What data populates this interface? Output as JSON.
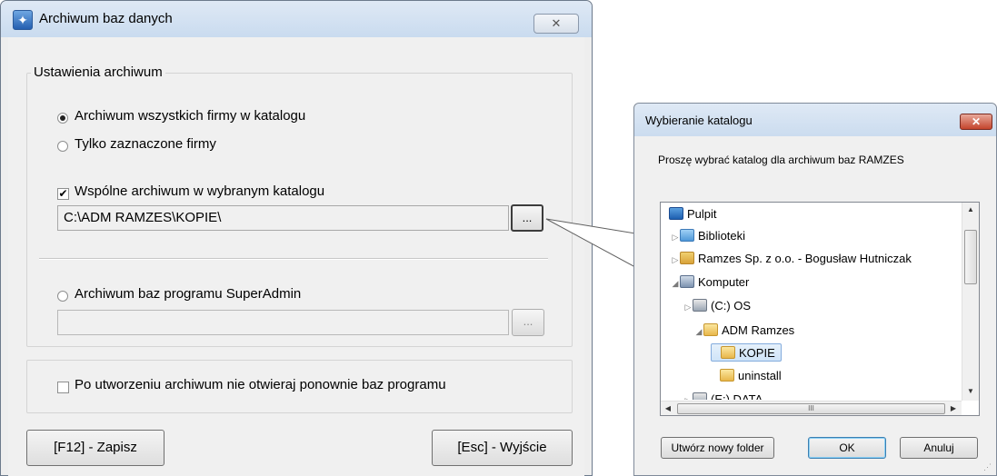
{
  "main_window": {
    "title": "Archiwum baz danych",
    "close_label": "✕",
    "group_title": "Ustawienia archiwum",
    "radio_all": "Archiwum wszystkich firmy w katalogu",
    "radio_selected": "Tylko zaznaczone firmy",
    "checkbox_common": "Wspólne archiwum w wybranym katalogu",
    "checkbox_common_checked": true,
    "path_value": "C:\\ADM RAMZES\\KOPIE\\",
    "browse_label": "...",
    "radio_superadmin": "Archiwum baz programu SuperAdmin",
    "superadmin_path": "",
    "browse2_label": "...",
    "checkbox_noreopen": "Po utworzeniu archiwum nie otwieraj ponownie baz programu",
    "save_button": "[F12] - Zapisz",
    "exit_button": "[Esc] - Wyjście"
  },
  "folder_dialog": {
    "title": "Wybieranie katalogu",
    "close_label": "✕",
    "prompt": "Proszę wybrać katalog dla archiwum baz RAMZES",
    "tree": [
      {
        "label": "Pulpit",
        "icon": "desktop-icon",
        "arrow": ""
      },
      {
        "label": "Biblioteki",
        "icon": "libraries-icon",
        "arrow": "▷"
      },
      {
        "label": "Ramzes Sp. z o.o. - Bogusław Hutniczak",
        "icon": "user-folder-icon",
        "arrow": "▷"
      },
      {
        "label": "Komputer",
        "icon": "computer-icon",
        "arrow": "◢"
      },
      {
        "label": "(C:) OS",
        "icon": "drive-icon",
        "arrow": "▷"
      },
      {
        "label": "ADM Ramzes",
        "icon": "folder-icon",
        "arrow": "◢"
      },
      {
        "label": "KOPIE",
        "icon": "folder-icon",
        "arrow": "",
        "selected": true
      },
      {
        "label": "uninstall",
        "icon": "folder-icon",
        "arrow": ""
      },
      {
        "label": "(E:) DATA",
        "icon": "drive-icon",
        "arrow": "▷"
      }
    ],
    "hscroll_grip": "III",
    "new_folder_button": "Utwórz nowy folder",
    "ok_button": "OK",
    "cancel_button": "Anuluj"
  }
}
